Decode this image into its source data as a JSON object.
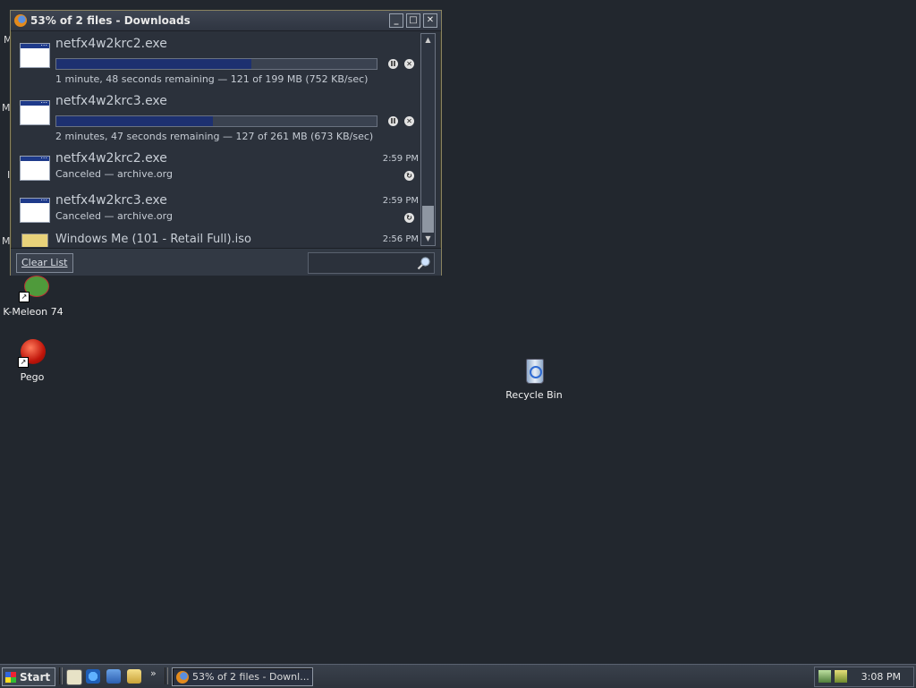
{
  "window": {
    "title": "53% of 2 files - Downloads",
    "controls": {
      "minimize": "_",
      "maximize": "□",
      "close": "✕"
    }
  },
  "downloads": [
    {
      "name": "netfx4w2krc2.exe",
      "progress": 0.61,
      "status": "1 minute, 48 seconds remaining — 121 of 199 MB (752 KB/sec)"
    },
    {
      "name": "netfx4w2krc3.exe",
      "progress": 0.49,
      "status": "2 minutes, 47 seconds remaining — 127 of 261 MB (673 KB/sec)"
    }
  ],
  "finished": [
    {
      "name": "netfx4w2krc2.exe",
      "time": "2:59 PM",
      "status": "Canceled — archive.org"
    },
    {
      "name": "netfx4w2krc3.exe",
      "time": "2:59 PM",
      "status": "Canceled — archive.org"
    },
    {
      "name": "Windows Me (101 - Retail Full).iso",
      "time": "2:56 PM"
    }
  ],
  "bottombar": {
    "clear_label": "Clear List"
  },
  "desktop": {
    "icons": [
      {
        "label": "K-Meleon 74"
      },
      {
        "label": "Pego"
      },
      {
        "label": "Recycle Bin"
      }
    ],
    "edge_fragments": [
      "M",
      "M",
      "I",
      "M"
    ]
  },
  "taskbar": {
    "start_label": "Start",
    "quick_launch_more": "»",
    "task_label": "53% of 2 files - Downl...",
    "clock": "3:08 PM"
  },
  "colors": {
    "desktop": "#22272e",
    "progress_fill": "#1d3070",
    "window_border": "#8a8360"
  }
}
